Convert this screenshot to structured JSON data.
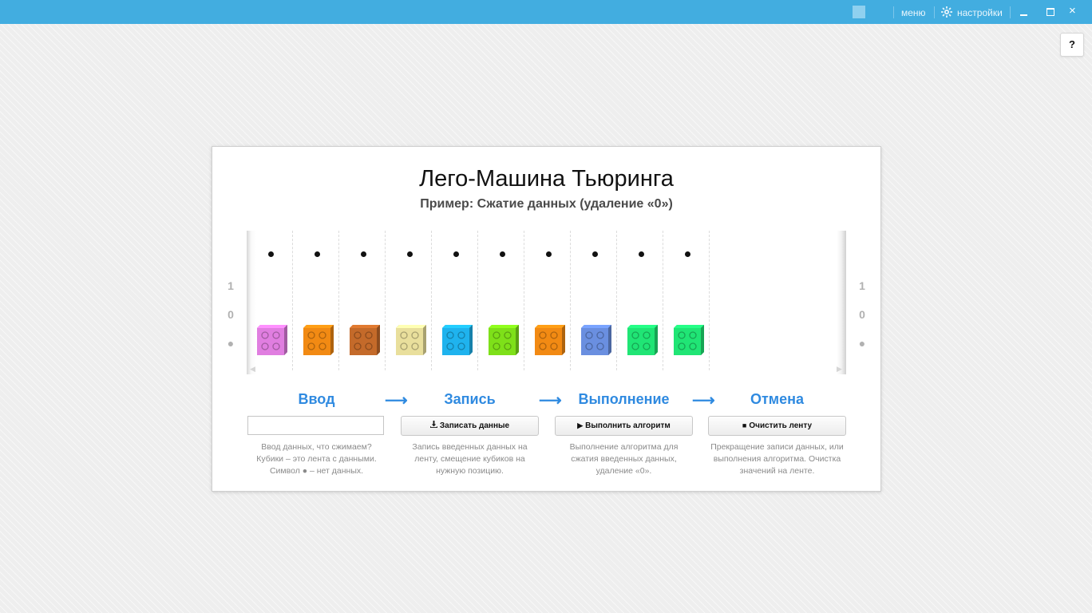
{
  "titlebar": {
    "menu_label": "меню",
    "settings_label": "настройки",
    "minimize_icon": "minimize-icon",
    "maximize_icon": "maximize-icon",
    "close_glyph": "×"
  },
  "help": {
    "label": "?"
  },
  "card": {
    "title": "Лего-Машина Тьюринга",
    "subtitle": "Пример: Сжатие данных (удаление «0»)"
  },
  "tape": {
    "row_labels": [
      "1",
      "0",
      "●"
    ],
    "cells": [
      {
        "top": "•",
        "brick_color": "#e07ee0"
      },
      {
        "top": "•",
        "brick_color": "#f28a13"
      },
      {
        "top": "•",
        "brick_color": "#c46a2a"
      },
      {
        "top": "•",
        "brick_color": "#e9df9c"
      },
      {
        "top": "•",
        "brick_color": "#1fb3ee"
      },
      {
        "top": "•",
        "brick_color": "#7ee019"
      },
      {
        "top": "•",
        "brick_color": "#f28a13"
      },
      {
        "top": "•",
        "brick_color": "#6a8fe0"
      },
      {
        "top": "•",
        "brick_color": "#20e575"
      },
      {
        "top": "•",
        "brick_color": "#20e575"
      }
    ]
  },
  "steps": [
    {
      "title": "Ввод",
      "desc": "Ввод данных, что сжимаем? Кубики – это лента с данными. Символ ● – нет данных."
    },
    {
      "title": "Запись",
      "button": "Записать данные",
      "button_icon": "download-icon",
      "desc": "Запись введенных данных на ленту, смещение кубиков на нужную позицию."
    },
    {
      "title": "Выполнение",
      "button": "Выполнить алгоритм",
      "button_icon": "play-icon",
      "desc": "Выполнение алгоритма для сжатия введенных данных, удаление «0»."
    },
    {
      "title": "Отмена",
      "button": "Очистить ленту",
      "button_icon": "stop-icon",
      "desc": "Прекращение записи данных, или выполнения алгоритма. Очистка значений на ленте."
    }
  ],
  "input": {
    "value": "",
    "placeholder": ""
  },
  "arrow_glyph": "⟶",
  "colors": {
    "titlebar": "#42ade0",
    "accent": "#2f8ae0"
  }
}
